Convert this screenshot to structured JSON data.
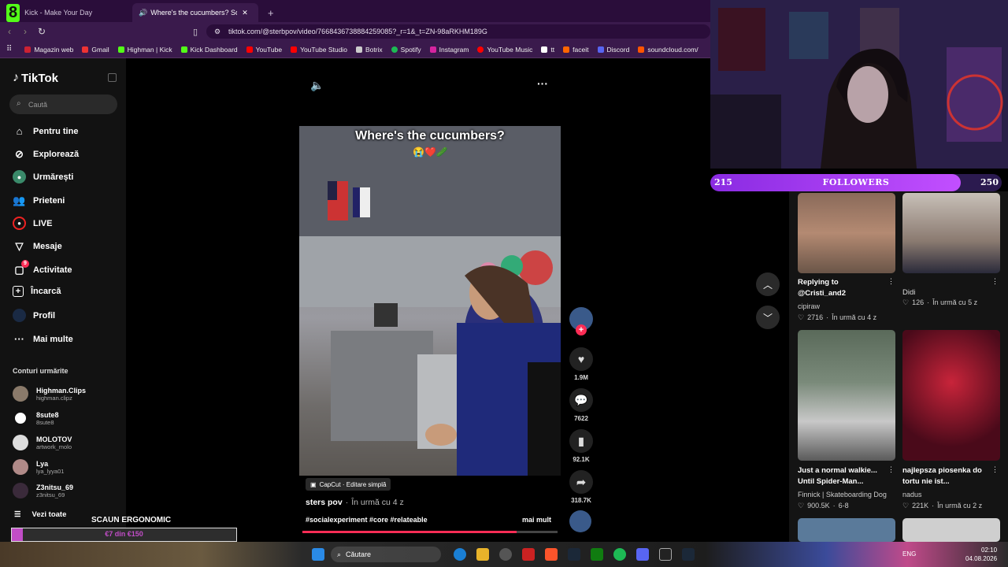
{
  "browser": {
    "tabs": [
      {
        "label": "Kick - Make Your Day"
      },
      {
        "label": "Where's the cucumbers? Soci"
      }
    ],
    "url": "tiktok.com/@sterbpov/video/7668436738884259085?_r=1&_t=ZN-98aRKHM189G",
    "bookmarks": [
      {
        "label": "Magazin web",
        "color": "#c23"
      },
      {
        "label": "Gmail",
        "color": "#e33"
      },
      {
        "label": "Highman | Kick",
        "color": "#53fc18"
      },
      {
        "label": "Kick Dashboard",
        "color": "#53fc18"
      },
      {
        "label": "YouTube",
        "color": "#f00"
      },
      {
        "label": "YouTube Studio",
        "color": "#f00"
      },
      {
        "label": "Botrix",
        "color": "#ccc"
      },
      {
        "label": "Spotify",
        "color": "#1db954"
      },
      {
        "label": "Instagram",
        "color": "#d6249f"
      },
      {
        "label": "YouTube Music",
        "color": "#f00"
      },
      {
        "label": "tt",
        "color": "#fff"
      },
      {
        "label": "faceit",
        "color": "#f60"
      },
      {
        "label": "Discord",
        "color": "#5865f2"
      },
      {
        "label": "soundcloud.com/",
        "color": "#f50"
      }
    ]
  },
  "kick_logo": "8",
  "tiktok": {
    "logo": "TikTok",
    "search_placeholder": "Caută",
    "nav": [
      {
        "label": "Pentru tine",
        "icon": "home-icon"
      },
      {
        "label": "Explorează",
        "icon": "compass-icon"
      },
      {
        "label": "Urmărești",
        "icon": "following-icon"
      },
      {
        "label": "Prieteni",
        "icon": "friends-icon"
      },
      {
        "label": "LIVE",
        "icon": "live-icon"
      },
      {
        "label": "Mesaje",
        "icon": "message-icon"
      },
      {
        "label": "Activitate",
        "icon": "activity-icon"
      },
      {
        "label": "Încarcă",
        "icon": "upload-icon"
      },
      {
        "label": "Profil",
        "icon": "profile-icon"
      },
      {
        "label": "Mai multe",
        "icon": "more-icon"
      }
    ],
    "activity_badge": "9",
    "following_title": "Conturi urmărite",
    "following": [
      {
        "name": "Highman.Clips",
        "handle": "highman.clipz"
      },
      {
        "name": "8sute8",
        "handle": "8sute8"
      },
      {
        "name": "MOLOTOV",
        "handle": "artwork_molo"
      },
      {
        "name": "Lya",
        "handle": "lya_lyya01"
      },
      {
        "name": "Z3nitsu_69",
        "handle": "z3nitsu_69"
      }
    ],
    "see_all": "Vezi toate",
    "video": {
      "caption_overlay": "Where's the cucumbers?",
      "capcut": "CapCut · Editare simplă",
      "author": "sters pov",
      "time": "În urmă cu 4 z",
      "hashtags": "#socialexperiment #core #relateable",
      "more": "mai mult",
      "progress": 0.84
    },
    "rail": {
      "likes": "1.9M",
      "comments": "7622",
      "saves": "92.1K",
      "shares": "318.7K"
    },
    "right_videos": [
      {
        "caption": "Replying to @Cristi_and2",
        "author": "cipiraw",
        "likes": "2716",
        "time": "În urmă cu 4 z"
      },
      {
        "caption": "Didi",
        "author": "",
        "likes": "126",
        "time": "În urmă cu 5 z"
      },
      {
        "caption": "Just a normal walkie... Until Spider-Man...",
        "author": "Finnick | Skateboarding Dog",
        "likes": "900.5K",
        "time": "6-8"
      },
      {
        "caption": "najlepsza piosenka do tortu nie ist...",
        "author": "nadus",
        "likes": "221K",
        "time": "În urmă cu 2 z"
      }
    ]
  },
  "stream": {
    "followers_label": "FOLLOWERS",
    "followers_current": "215",
    "followers_goal": "250",
    "followers_progress": 0.86,
    "goal_title": "SCAUN ERGONOMIC",
    "goal_amount": "€7 din €150",
    "goal_progress": 0.05
  },
  "taskbar": {
    "search": "Căutare",
    "lang": "ENG",
    "time": "02:10",
    "date": "04.08.2026"
  }
}
